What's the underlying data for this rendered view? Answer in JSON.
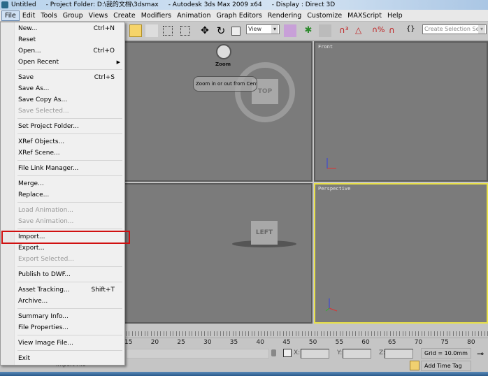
{
  "window": {
    "title_parts": [
      "Untitled",
      "- Project Folder: D:\\我的文档\\3dsmax",
      "- Autodesk 3ds Max  2009 x64",
      "- Display : Direct 3D"
    ]
  },
  "menubar": [
    "File",
    "Edit",
    "Tools",
    "Group",
    "Views",
    "Create",
    "Modifiers",
    "Animation",
    "Graph Editors",
    "Rendering",
    "Customize",
    "MAXScript",
    "Help"
  ],
  "toolbar": {
    "view_dropdown": "View",
    "selection_set_placeholder": "Create Selection Set"
  },
  "viewports": {
    "top_left": {
      "navcube": "TOP",
      "tool_label": "Zoom",
      "tooltip": "Zoom in or out from Center"
    },
    "front": {
      "label": "Front"
    },
    "left": {
      "navcube": "LEFT"
    },
    "perspective": {
      "label": "Perspective"
    }
  },
  "timeline": {
    "ticks": [
      "15",
      "20",
      "25",
      "30",
      "35",
      "40",
      "45",
      "50",
      "55",
      "60",
      "65",
      "70",
      "75",
      "80"
    ]
  },
  "status": {
    "x_label": "X:",
    "y_label": "Y:",
    "z_label": "Z:",
    "grid": "Grid = 10.0mm",
    "add_time_tag": "Add Time Tag",
    "prompt": "Import File"
  },
  "file_menu": [
    {
      "label": "New...",
      "shortcut": "Ctrl+N"
    },
    {
      "label": "Reset"
    },
    {
      "label": "Open...",
      "shortcut": "Ctrl+O"
    },
    {
      "label": "Open Recent",
      "submenu": true
    },
    "sep",
    {
      "label": "Save",
      "shortcut": "Ctrl+S"
    },
    {
      "label": "Save As..."
    },
    {
      "label": "Save Copy As..."
    },
    {
      "label": "Save Selected...",
      "disabled": true
    },
    "sep",
    {
      "label": "Set Project Folder..."
    },
    "sep",
    {
      "label": "XRef Objects..."
    },
    {
      "label": "XRef Scene..."
    },
    "sep",
    {
      "label": "File Link Manager..."
    },
    "sep",
    {
      "label": "Merge..."
    },
    {
      "label": "Replace..."
    },
    "sep",
    {
      "label": "Load Animation...",
      "disabled": true
    },
    {
      "label": "Save Animation...",
      "disabled": true
    },
    "sep",
    {
      "label": "Import...",
      "highlighted": true
    },
    {
      "label": "Export..."
    },
    {
      "label": "Export Selected...",
      "disabled": true
    },
    "sep",
    {
      "label": "Publish to DWF..."
    },
    "sep",
    {
      "label": "Asset Tracking...",
      "shortcut": "Shift+T"
    },
    {
      "label": "Archive..."
    },
    "sep",
    {
      "label": "Summary Info..."
    },
    {
      "label": "File Properties..."
    },
    "sep",
    {
      "label": "View Image File..."
    },
    "sep",
    {
      "label": "Exit"
    }
  ],
  "colors": {
    "highlight_box": "#d01010",
    "active_viewport": "#e8e04a"
  }
}
